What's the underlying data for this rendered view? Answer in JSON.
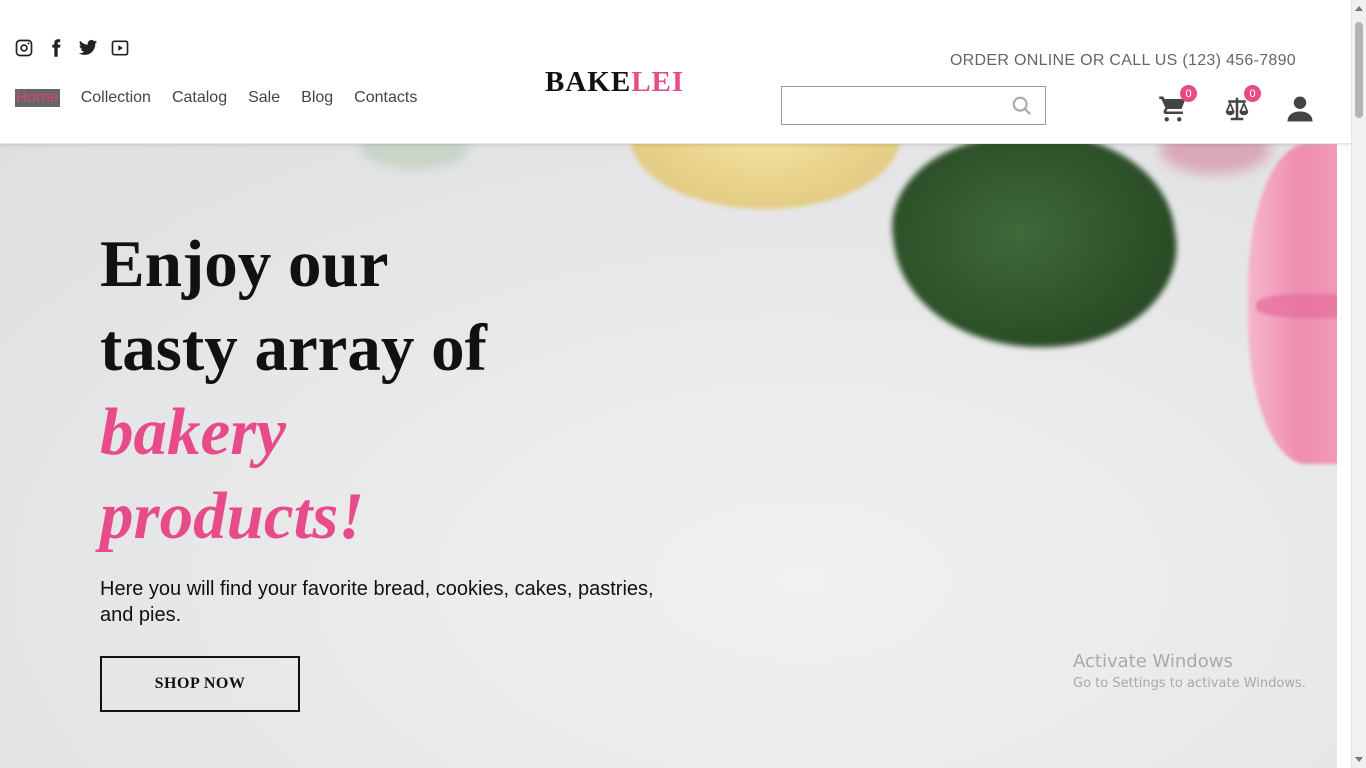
{
  "header": {
    "social_icons": [
      "instagram-icon",
      "facebook-icon",
      "twitter-icon",
      "youtube-icon"
    ],
    "nav": [
      {
        "label": "Home",
        "active": true
      },
      {
        "label": "Collection"
      },
      {
        "label": "Catalog"
      },
      {
        "label": "Sale"
      },
      {
        "label": "Blog"
      },
      {
        "label": "Contacts"
      }
    ],
    "logo_part1": "BAKE",
    "logo_part2": "LEI",
    "contact_text": "ORDER ONLINE OR CALL US (123) 456-7890",
    "search_value": "",
    "cart_count": "0",
    "compare_count": "0"
  },
  "hero": {
    "title_line1": "Enjoy our",
    "title_line2": "tasty array of",
    "title_line3": "bakery",
    "title_line4": "products!",
    "subtitle": "Here you will find your favorite bread, cookies, cakes, pastries, and pies.",
    "button_label": "SHOP NOW"
  },
  "watermark": {
    "title": "Activate Windows",
    "subtitle": "Go to Settings to activate Windows."
  },
  "colors": {
    "accent_pink": "#e84b8a",
    "text_dark": "#111111"
  }
}
